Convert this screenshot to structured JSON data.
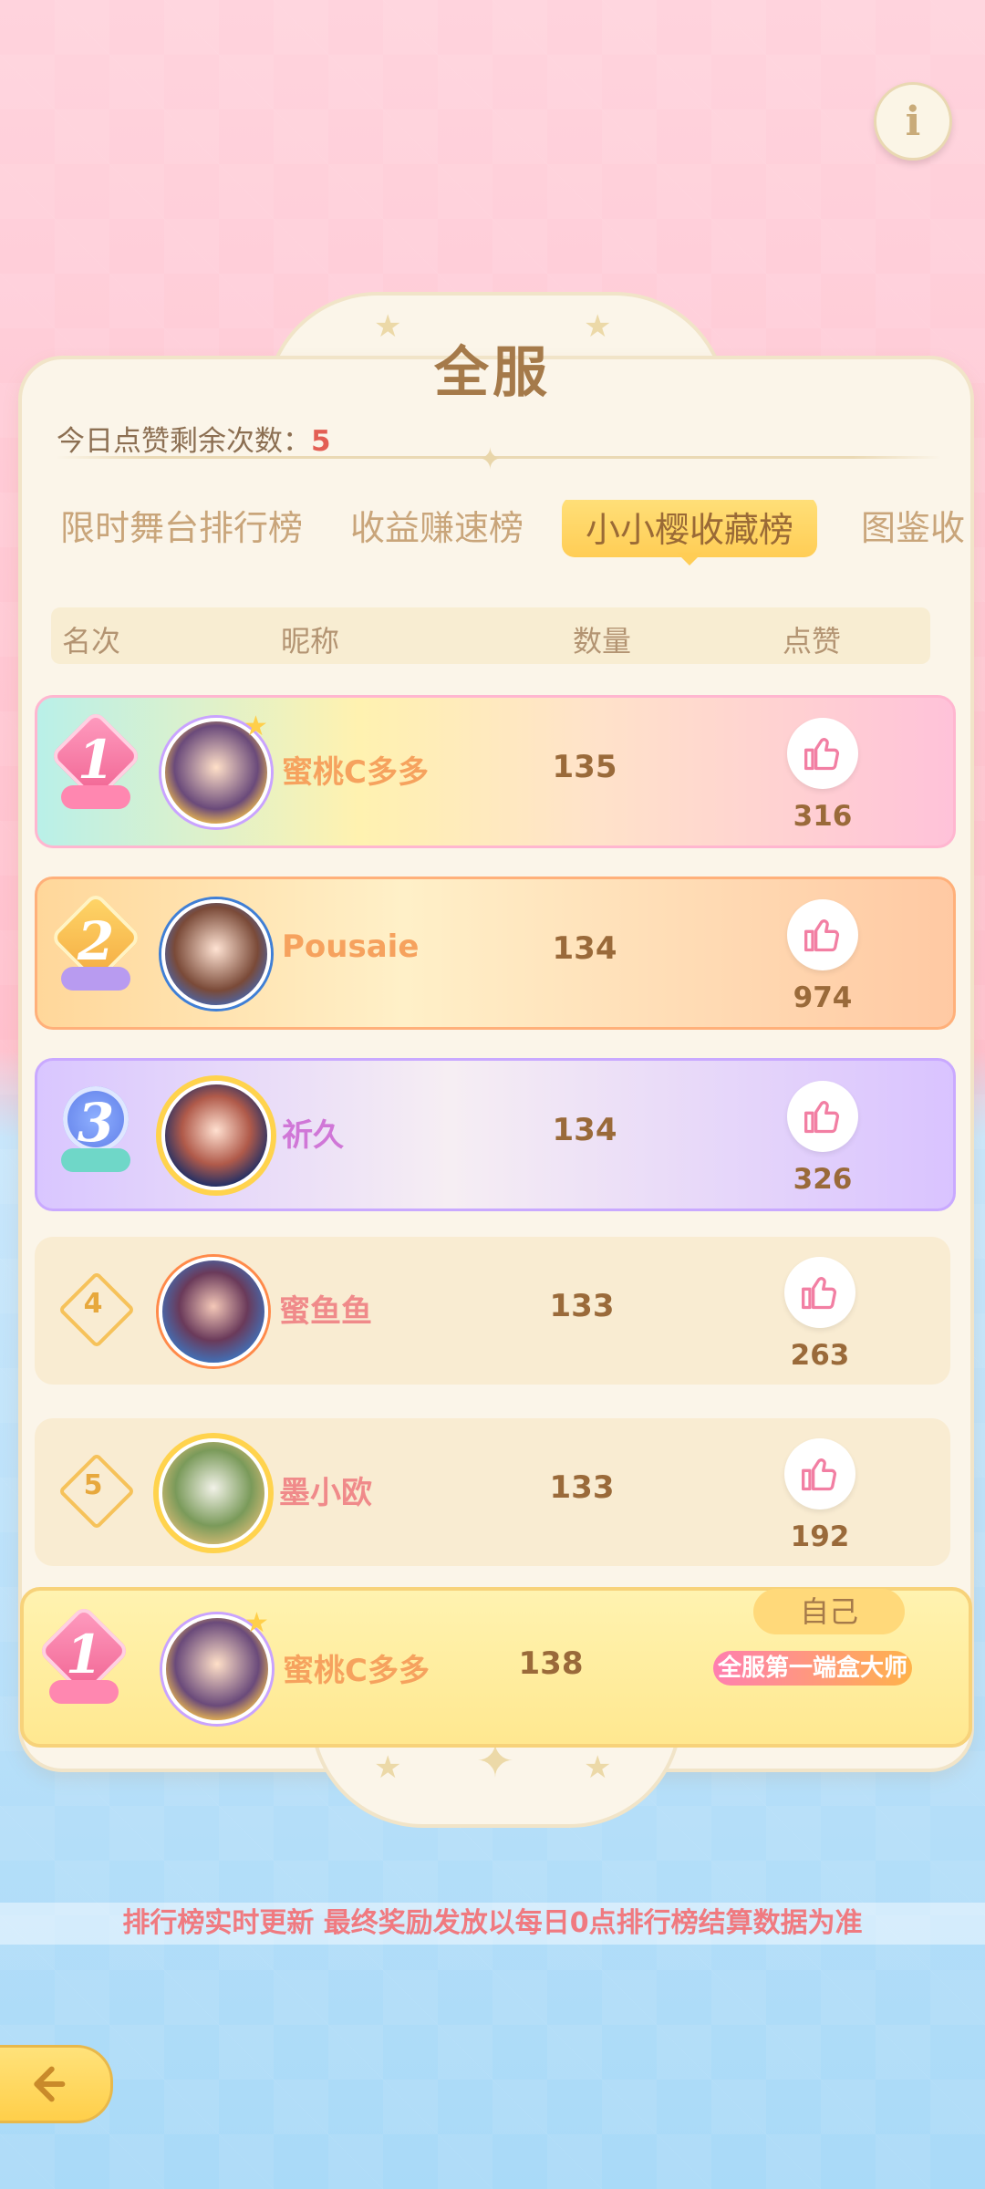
{
  "header": {
    "title": "全服",
    "info_icon": "info-icon"
  },
  "likes": {
    "label": "今日点赞剩余次数：",
    "remaining": "5"
  },
  "tabs": [
    {
      "label": "限时舞台排行榜",
      "active": false
    },
    {
      "label": "收益赚速榜",
      "active": false
    },
    {
      "label": "小小樱收藏榜",
      "active": true
    },
    {
      "label": "图鉴收",
      "active": false
    }
  ],
  "table": {
    "headers": {
      "rank": "名次",
      "nickname": "昵称",
      "quantity": "数量",
      "like": "点赞"
    },
    "rows": [
      {
        "rank": "1",
        "name": "蜜桃C多多",
        "quantity": "135",
        "likes": "316"
      },
      {
        "rank": "2",
        "name": "Pousaie",
        "quantity": "134",
        "likes": "974"
      },
      {
        "rank": "3",
        "name": "祈久",
        "quantity": "134",
        "likes": "326"
      },
      {
        "rank": "4",
        "name": "蜜鱼鱼",
        "quantity": "133",
        "likes": "263"
      },
      {
        "rank": "5",
        "name": "墨小欧",
        "quantity": "133",
        "likes": "192"
      }
    ]
  },
  "self": {
    "tag": "自己",
    "rank": "1",
    "name": "蜜桃C多多",
    "quantity": "138",
    "title_badge": "全服第一端盒大师"
  },
  "notice": "排行榜实时更新 最终奖励发放以每日0点排行榜结算数据为准",
  "colors": {
    "accent_gold": "#ffcd55",
    "text_brown": "#9a6a3a",
    "highlight_red": "#e35f54"
  }
}
